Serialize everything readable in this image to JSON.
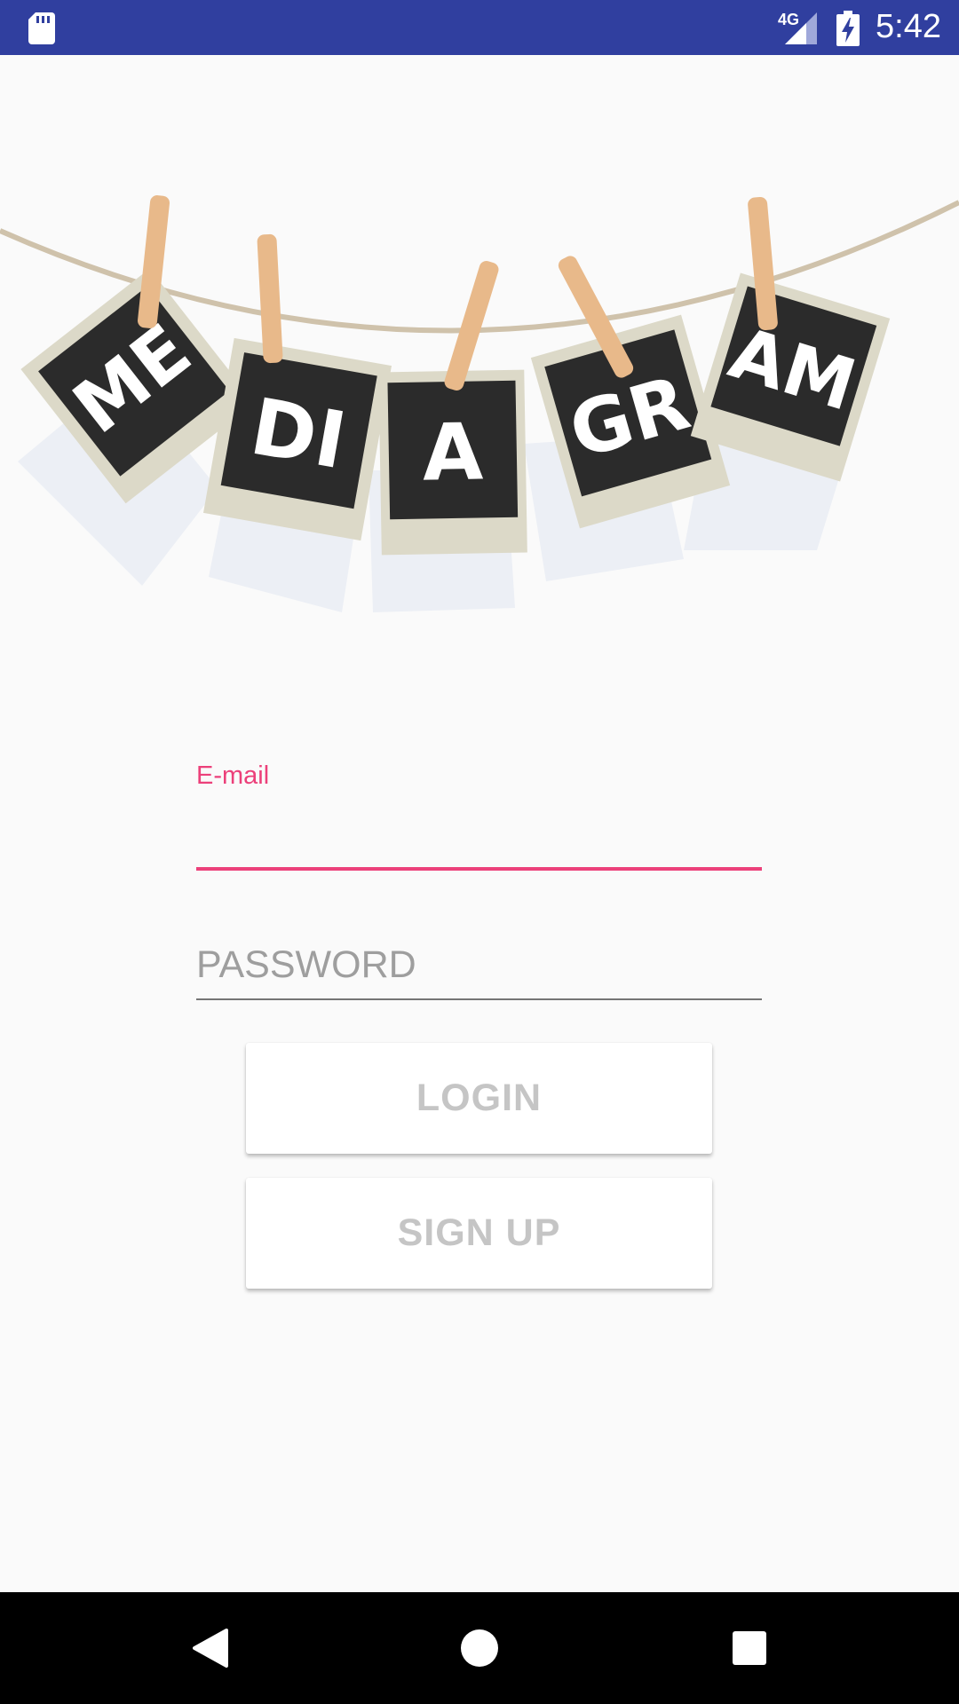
{
  "status_bar": {
    "network_type": "4G",
    "clock": "5:42",
    "icons": [
      "sd-card-icon",
      "signal-icon",
      "battery-charging-icon"
    ]
  },
  "logo": {
    "cards": [
      "ME",
      "DI",
      "A",
      "GR",
      "AM"
    ]
  },
  "form": {
    "email_label": "E-mail",
    "email_value": "",
    "password_placeholder": "PASSWORD",
    "login_label": "LOGIN",
    "signup_label": "SIGN UP"
  },
  "colors": {
    "status_bar": "#303f9f",
    "accent": "#ec407a",
    "background": "#fafafa",
    "card": "#2b2b2b",
    "polaroid": "#dcd9c8",
    "pin": "#e8b98a"
  },
  "nav_bar": {
    "icons": [
      "back-icon",
      "home-icon",
      "recents-icon"
    ]
  }
}
